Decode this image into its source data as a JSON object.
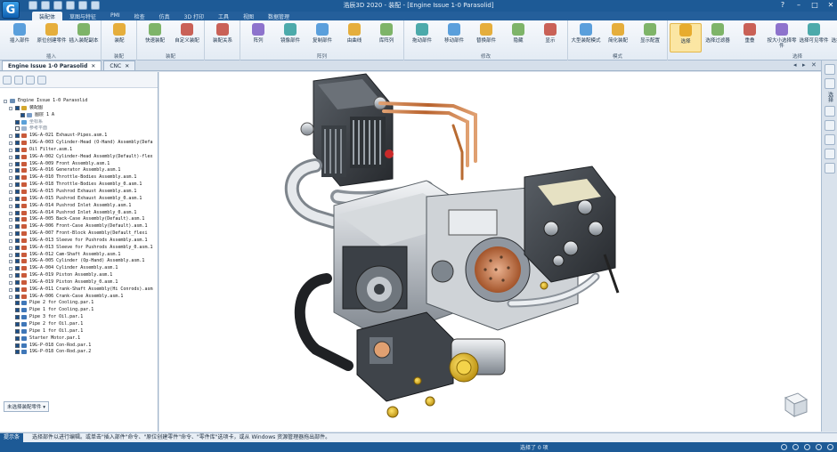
{
  "app": {
    "logo": "G",
    "window_title": "浩辰3D 2020 - 装配 - [Engine Issue 1-0 Parasolid]",
    "window_buttons": [
      "minimize",
      "maximize",
      "close"
    ]
  },
  "ribbon_tabs": [
    {
      "label": "装配体",
      "active": true
    },
    {
      "label": "草图与特征",
      "active": false
    },
    {
      "label": "PMI",
      "active": false
    },
    {
      "label": "检查",
      "active": false
    },
    {
      "label": "仿真",
      "active": false
    },
    {
      "label": "3D 打印",
      "active": false
    },
    {
      "label": "工具",
      "active": false
    },
    {
      "label": "视图",
      "active": false
    },
    {
      "label": "数据管理",
      "active": false
    }
  ],
  "ribbon_groups": [
    {
      "label": "插入",
      "buttons": [
        {
          "label": "插入部件",
          "icon": "insert-part-icon"
        },
        {
          "label": "原位创建零件",
          "icon": "create-in-place-icon"
        },
        {
          "label": "插入装配副本",
          "icon": "insert-copy-icon"
        }
      ]
    },
    {
      "label": "装配",
      "buttons": [
        {
          "label": "装配",
          "icon": "assemble-icon"
        }
      ]
    },
    {
      "label": "装配",
      "buttons": [
        {
          "label": "快速装配",
          "icon": "quick-assemble-icon"
        },
        {
          "label": "自定义装配",
          "icon": "custom-assemble-icon"
        }
      ]
    },
    {
      "label": "",
      "buttons": [
        {
          "label": "装配关系",
          "icon": "relations-icon"
        }
      ]
    },
    {
      "label": "阵列",
      "buttons": [
        {
          "label": "阵列",
          "icon": "pattern-icon"
        },
        {
          "label": "镜像部件",
          "icon": "mirror-icon"
        },
        {
          "label": "复制部件",
          "icon": "copy-part-icon"
        },
        {
          "label": "由曲线",
          "icon": "along-curve-icon"
        },
        {
          "label": "库阵列",
          "icon": "lib-pattern-icon"
        }
      ]
    },
    {
      "label": "修改",
      "buttons": [
        {
          "label": "拖动部件",
          "icon": "drag-icon"
        },
        {
          "label": "移动部件",
          "icon": "move-icon"
        },
        {
          "label": "替换部件",
          "icon": "replace-icon"
        },
        {
          "label": "隐藏",
          "icon": "hide-icon"
        },
        {
          "label": "显示",
          "icon": "show-icon"
        }
      ]
    },
    {
      "label": "模式",
      "buttons": [
        {
          "label": "大型装配模式",
          "icon": "large-asm-icon"
        },
        {
          "label": "简化装配",
          "icon": "simplify-icon"
        },
        {
          "label": "显示配置",
          "icon": "display-config-icon"
        }
      ]
    },
    {
      "label": "选择",
      "buttons": [
        {
          "label": "选择",
          "icon": "cursor-icon",
          "selected": true
        },
        {
          "label": "选择过滤器",
          "icon": "filter-icon"
        },
        {
          "label": "重叠",
          "icon": "overlap-icon"
        },
        {
          "label": "按大小选择零件",
          "icon": "size-select-icon"
        },
        {
          "label": "选择可见零件",
          "icon": "visible-select-icon"
        },
        {
          "label": "选择约束的零件",
          "icon": "constraint-select-icon"
        },
        {
          "label": "激活",
          "icon": "activate-icon"
        },
        {
          "label": "更新部件",
          "icon": "update-icon"
        }
      ]
    }
  ],
  "doc_tabs": [
    {
      "label": "Engine Issue 1-0 Parasolid",
      "active": true
    },
    {
      "label": "CNC",
      "active": false
    }
  ],
  "tree": {
    "root": "Engine Issue 1-0 Parasolid",
    "items": [
      {
        "label": "装配图",
        "depth": 1,
        "icon": "folder",
        "checked": true
      },
      {
        "label": "图层 1 A",
        "depth": 2,
        "icon": "layer",
        "checked": true
      },
      {
        "label": "坐标系",
        "depth": 1,
        "icon": "coord",
        "checked": true,
        "dim": true
      },
      {
        "label": "参考平面",
        "depth": 1,
        "icon": "plane",
        "checked": false,
        "dim": true
      },
      {
        "label": "19G-A-021 Exhaust-Pipes.asm.1",
        "depth": 1,
        "icon": "asm",
        "checked": true
      },
      {
        "label": "19G-A-003 Cylinder-Head (O-Hand) Assembly(Defa",
        "depth": 1,
        "icon": "asm",
        "checked": true
      },
      {
        "label": "Oil Filter.asm.1",
        "depth": 1,
        "icon": "asm",
        "checked": true
      },
      {
        "label": "19G-A-002 Cylinder-Head Assembly(Default)-flex",
        "depth": 1,
        "icon": "asm",
        "checked": true
      },
      {
        "label": "19G-A-009 Front Assembly.asm.1",
        "depth": 1,
        "icon": "asm",
        "checked": true
      },
      {
        "label": "19G-A-016 Generator Assembly.asm.1",
        "depth": 1,
        "icon": "asm",
        "checked": true
      },
      {
        "label": "19G-A-010 Throttle-Bodies Assembly.asm.1",
        "depth": 1,
        "icon": "asm",
        "checked": true
      },
      {
        "label": "19G-A-018 Throttle-Bodies Assembly_0.asm.1",
        "depth": 1,
        "icon": "asm",
        "checked": true
      },
      {
        "label": "19G-A-015 Pushrod Exhaust Assembly.asm.1",
        "depth": 1,
        "icon": "asm",
        "checked": true
      },
      {
        "label": "19G-A-015 Pushrod Exhaust Assembly_0.asm.1",
        "depth": 1,
        "icon": "asm",
        "checked": true
      },
      {
        "label": "19G-A-014 Pushrod Inlet Assembly.asm.1",
        "depth": 1,
        "icon": "asm",
        "checked": true
      },
      {
        "label": "19G-A-014 Pushrod Inlet Assembly_0.asm.1",
        "depth": 1,
        "icon": "asm",
        "checked": true
      },
      {
        "label": "19G-A-005 Back-Case Assembly(Default).asm.1",
        "depth": 1,
        "icon": "asm",
        "checked": true
      },
      {
        "label": "19G-A-006 Front-Case Assembly(Default).asm.1",
        "depth": 1,
        "icon": "asm",
        "checked": true
      },
      {
        "label": "19G-A-007 Front-Block Assembly(Default_flexi",
        "depth": 1,
        "icon": "asm",
        "checked": true
      },
      {
        "label": "19G-A-013 Sleeve for Pushrods Assembly.asm.1",
        "depth": 1,
        "icon": "asm",
        "checked": true
      },
      {
        "label": "19G-A-013 Sleeve for Pushrods Assembly_0.asm.1",
        "depth": 1,
        "icon": "asm",
        "checked": true
      },
      {
        "label": "19G-A-012 Cam-Shaft Assembly.asm.1",
        "depth": 1,
        "icon": "asm",
        "checked": true
      },
      {
        "label": "19G-A-005 Cylinder (Op-Hand) Assembly.asm.1",
        "depth": 1,
        "icon": "asm",
        "checked": true
      },
      {
        "label": "19G-A-004 Cylinder Assembly.asm.1",
        "depth": 1,
        "icon": "asm",
        "checked": true
      },
      {
        "label": "19G-A-019 Piston Assembly.asm.1",
        "depth": 1,
        "icon": "asm",
        "checked": true
      },
      {
        "label": "19G-A-019 Piston Assembly_0.asm.1",
        "depth": 1,
        "icon": "asm",
        "checked": true
      },
      {
        "label": "19G-A-011 Crank-Shaft Assembly(Hi Conrods).asm",
        "depth": 1,
        "icon": "asm",
        "checked": true
      },
      {
        "label": "19G-A-006 Crank-Case Assembly.asm.1",
        "depth": 1,
        "icon": "asm",
        "checked": true
      },
      {
        "label": "Pipe 2 for Cooling.par.1",
        "depth": 1,
        "icon": "part",
        "checked": true
      },
      {
        "label": "Pipe 1 for Cooling.par.1",
        "depth": 1,
        "icon": "part",
        "checked": true
      },
      {
        "label": "Pipe 3 for Oil.par.1",
        "depth": 1,
        "icon": "part",
        "checked": true
      },
      {
        "label": "Pipe 2 for Oil.par.1",
        "depth": 1,
        "icon": "part",
        "checked": true
      },
      {
        "label": "Pipe 1 for Oil.par.1",
        "depth": 1,
        "icon": "part",
        "checked": true
      },
      {
        "label": "Starter Motor.par.1",
        "depth": 1,
        "icon": "part",
        "checked": true
      },
      {
        "label": "19G-P-018 Con-Rod.par.1",
        "depth": 1,
        "icon": "part",
        "checked": true
      },
      {
        "label": "19G-P-018 Con-Rod.par.2",
        "depth": 1,
        "icon": "part",
        "checked": true
      }
    ],
    "footer_button": "未选择装配零件 ▾"
  },
  "right_rail": {
    "label": "选择"
  },
  "command_bar": {
    "label": "提示条",
    "text": "选择部件以进行编辑。或单击\"插入部件\"命令、\"原位创建零件\"命令、\"零件库\"选项卡，或从 Windows 资源管理器拖出部件。"
  },
  "status": {
    "text": "选择了 0 项"
  },
  "colors": {
    "title_bar": "#1d5a96",
    "ribbon_bg": "#eef3f8",
    "selected_button": "#fbe6a3",
    "pipes_copper": "#c4733a",
    "engine_dark": "#3d4247",
    "engine_silver": "#c9cdd1",
    "fitting_gold": "#e0b11e"
  }
}
